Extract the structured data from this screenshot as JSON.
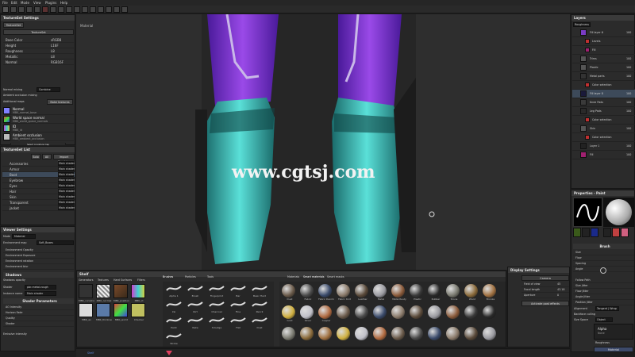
{
  "menu": [
    "File",
    "Edit",
    "Mode",
    "View",
    "Plugins",
    "Help"
  ],
  "viewport": {
    "label": "Material",
    "watermark": "www.cgtsj.com"
  },
  "texture_settings": {
    "title": "TextureSet Settings",
    "tab": "TextureSet",
    "props": [
      {
        "label": "Base Color",
        "value": "sRGB8"
      },
      {
        "label": "Height",
        "value": "L16F"
      },
      {
        "label": "Roughness",
        "value": "L8"
      },
      {
        "label": "Metallic",
        "value": "L8"
      },
      {
        "label": "Normal",
        "value": "RGB16F"
      }
    ],
    "normal_mixing_label": "Normal mixing",
    "normal_mixing_value": "Combine",
    "ao_mixing_label": "Ambient occlusion mixing",
    "additional_maps_label": "Additional maps",
    "bake_button": "Bake textures",
    "maps": [
      {
        "name": "Normal",
        "file": "MBK_normal_base"
      },
      {
        "name": "World space normal",
        "file": "MBK_world_space_normals"
      },
      {
        "name": "ID",
        "file": "MBK_id"
      },
      {
        "name": "Ambient occlusion",
        "file": "MBK_ambient_occlusion"
      }
    ],
    "select_map": "Select curvature map"
  },
  "textureset_list": {
    "title": "TextureSet List",
    "buttons": [
      "Solo",
      "All",
      "Import Graphics"
    ],
    "items": [
      {
        "name": "Accessories",
        "shader": "Main shader"
      },
      {
        "name": "Armor",
        "shader": "Main shader"
      },
      {
        "name": "Boot",
        "shader": "Main shader"
      },
      {
        "name": "Eyebrow",
        "shader": "Main shader"
      },
      {
        "name": "Eyes",
        "shader": "Main shader"
      },
      {
        "name": "Hair",
        "shader": "Main shader"
      },
      {
        "name": "Skin",
        "shader": "Main shader"
      },
      {
        "name": "Transparent",
        "shader": "Main shader"
      },
      {
        "name": "jacket",
        "shader": "Main shader"
      }
    ]
  },
  "viewer_settings": {
    "title": "Viewer Settings",
    "mode_label": "Mode",
    "mode_value": "Material",
    "env_map_label": "Environment map",
    "env_map_value": "Soft_Boxes",
    "rows": [
      "Environment Opacity",
      "Environment Exposure",
      "Environment rotation",
      "Environment blur"
    ],
    "shadows_label": "Shadows",
    "shadows_opacity": "Shadows opacity",
    "shader_label": "Shader",
    "shader_value": "pbr-metal-rough",
    "instance_label": "Instance name",
    "instance_value": "Main shader",
    "params_title": "Shader Parameters",
    "param_rows": [
      "AO Intensity",
      "Horizon Fade",
      "Quality",
      "Shader"
    ],
    "emissive": "Emissive intensity"
  },
  "shelf": {
    "title": "Shelf",
    "categories": [
      "Generators",
      "Textures",
      "Hard Surfaces",
      "Filters"
    ],
    "thumbs": [
      "MBK_curvature",
      "MBK_normal",
      "MBK_position",
      "MBK_id"
    ],
    "thumbs2": [
      "MBK_ao",
      "MBK_thickness",
      "MBK_world",
      "Checker"
    ],
    "brush_tabs": [
      "Brushes",
      "Particles",
      "Tools"
    ],
    "brushes": [
      "Alpha 1",
      "Brush",
      "Fingerprint",
      "Bar",
      "Basic Hard",
      "Ink",
      "Dirt",
      "Charcoal",
      "Fine",
      "Pencil",
      "Paint",
      "Rake",
      "Smudge",
      "Flat",
      "Dust",
      "Stroke"
    ],
    "mat_tabs": [
      "Materials",
      "Smart materials",
      "Smart masks"
    ],
    "materials": [
      "Dust",
      "Fabric",
      "Fabric Denim",
      "Fabric Knit",
      "Leather",
      "Metal",
      "Metal Rusty",
      "Plastic",
      "Rubber",
      "Stone",
      "Wood",
      "Bronze",
      "Gold",
      "Silver",
      "Copper"
    ]
  },
  "display_settings": {
    "title": "Display Settings",
    "section": "Camera",
    "rows": [
      {
        "label": "Field of view",
        "value": "45"
      },
      {
        "label": "Focal length",
        "value": "43.18"
      },
      {
        "label": "Aperture",
        "value": "0"
      }
    ],
    "button": "Activate post effects"
  },
  "layers": {
    "title": "Layers",
    "blend": "Roughness",
    "items": [
      {
        "name": "Fill layer 6",
        "opacity": "100",
        "icon": "#7a3bc4"
      },
      {
        "name": "Levels",
        "opacity": "",
        "icon": "#c03030"
      },
      {
        "name": "Fill",
        "opacity": "",
        "icon": "#a02070"
      },
      {
        "name": "Trims",
        "opacity": "100",
        "icon": "#555555"
      },
      {
        "name": "Plastic",
        "opacity": "100",
        "icon": "#555555"
      },
      {
        "name": "Metal parts",
        "opacity": "100",
        "icon": "#333333"
      },
      {
        "name": "Color selection",
        "opacity": "",
        "icon": "#c03030"
      },
      {
        "name": "Fill layer 8",
        "opacity": "100",
        "icon": "#1a1a3a"
      },
      {
        "name": "Knee Pads",
        "opacity": "100",
        "icon": "#3a3a3a"
      },
      {
        "name": "Leg Pads",
        "opacity": "100",
        "icon": "#2a2a2a"
      },
      {
        "name": "Color selection",
        "opacity": "",
        "icon": "#c03030"
      },
      {
        "name": "Skin",
        "opacity": "100",
        "icon": "#555555"
      },
      {
        "name": "Color selection",
        "opacity": "",
        "icon": "#c03030"
      },
      {
        "name": "Layer 1",
        "opacity": "100",
        "icon": "#222222"
      },
      {
        "name": "Fill",
        "opacity": "100",
        "icon": "#a02070"
      }
    ]
  },
  "properties": {
    "title": "Properties - Paint",
    "brush_title": "Brush",
    "brush_rows": [
      "Size",
      "Flow",
      "Spacing",
      "Angle"
    ],
    "alpha_rows": [
      "Follow Path",
      "Size Jitter",
      "Flow Jitter",
      "Angle Jitter",
      "Position Jitter"
    ],
    "alignment_label": "Alignment",
    "alignment_value": "Tangent | Wrap",
    "backface_label": "Backface culling",
    "size_space_label": "Size Space",
    "size_space_value": "Object",
    "alpha_label": "Alpha",
    "alpha_value": "None",
    "roughness_label": "Roughness",
    "material_button": "Material"
  },
  "status": {
    "frame": "Shelf"
  }
}
